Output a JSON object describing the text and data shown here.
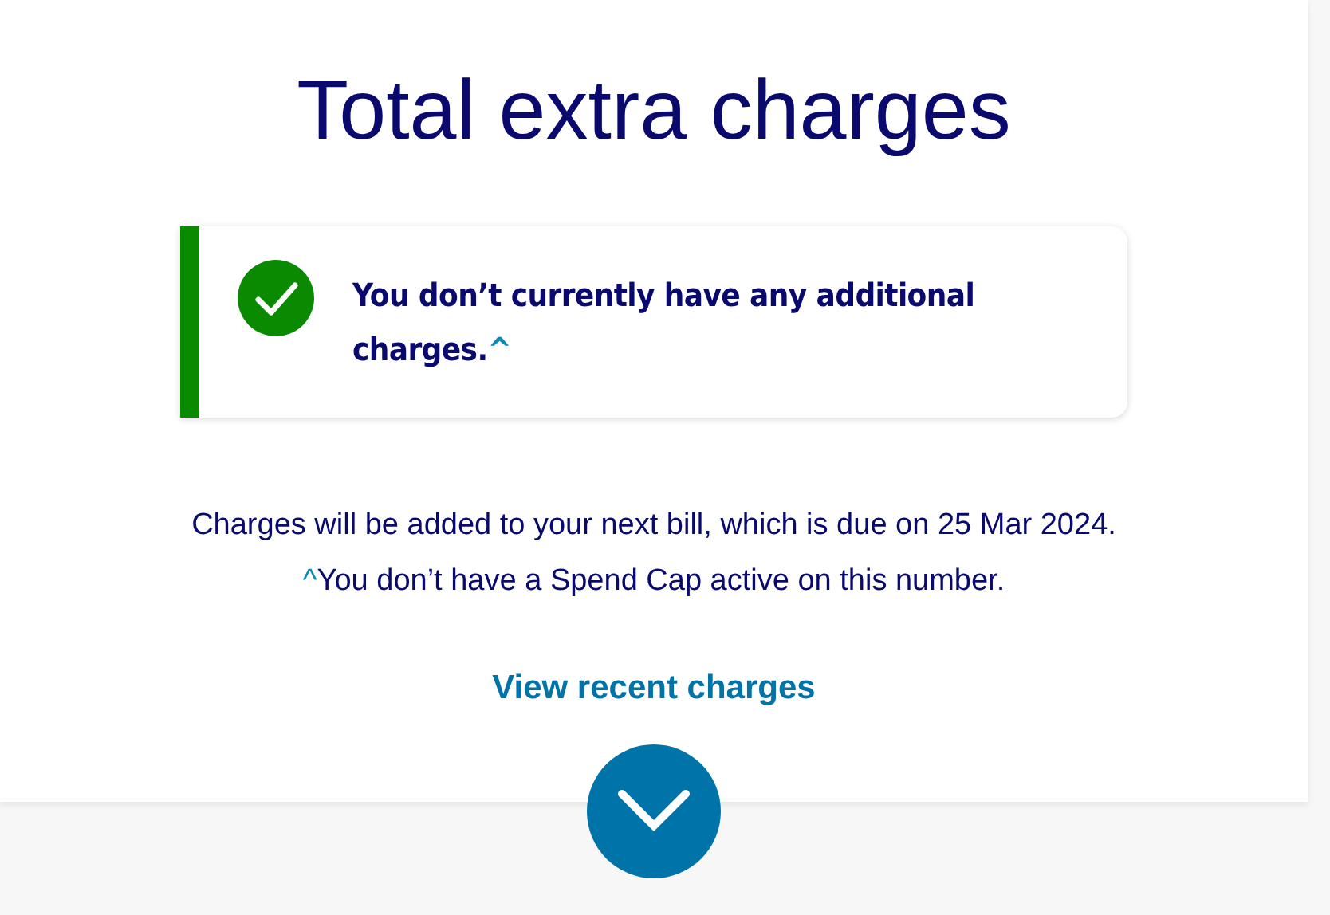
{
  "title": "Total extra charges",
  "alert": {
    "kind": "success",
    "message": "You don’t currently have any additional charges.",
    "mark": "^"
  },
  "info": {
    "text": "Charges will be added to your next bill, which is due on 25 Mar 2024.",
    "note_mark": "^",
    "note": "You don’t have a Spend Cap active on this number."
  },
  "link": "View recent charges",
  "expand_button": {
    "expanded": false
  }
}
